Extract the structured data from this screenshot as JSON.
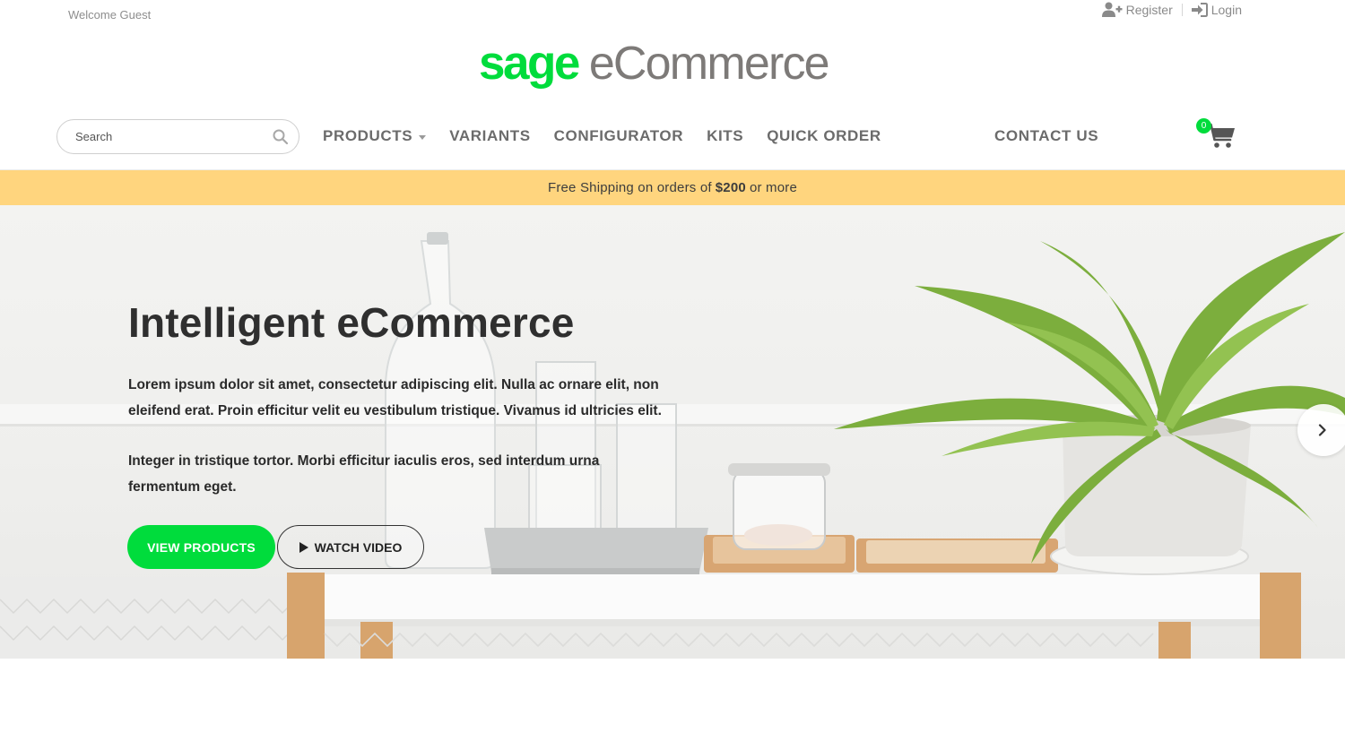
{
  "top_bar": {
    "welcome": "Welcome Guest",
    "register": "Register",
    "login": "Login"
  },
  "logo": {
    "brand": "sage",
    "product": "eCommerce"
  },
  "search": {
    "placeholder": "Search"
  },
  "nav": {
    "products": "PRODUCTS",
    "variants": "VARIANTS",
    "configurator": "CONFIGURATOR",
    "kits": "KITS",
    "quick_order": "QUICK ORDER",
    "contact_us": "CONTACT US"
  },
  "cart": {
    "count": "0"
  },
  "promo": {
    "prefix": "Free Shipping on orders of",
    "amount": "$200",
    "suffix": "or more"
  },
  "hero": {
    "title": "Intelligent eCommerce",
    "paragraph1": "Lorem ipsum dolor sit amet, consectetur adipiscing elit. Nulla ac ornare elit, non eleifend erat. Proin efficitur velit eu vestibulum tristique. Vivamus id ultricies elit.",
    "paragraph2": "Integer in tristique tortor. Morbi efficitur iaculis eros, sed interdum urna fermentum eget.",
    "primary_button": "VIEW PRODUCTS",
    "secondary_button": "WATCH VIDEO"
  },
  "colors": {
    "brand_green": "#00dc3c",
    "logo_gray": "#7d7a78",
    "promo_bg": "#ffd57e",
    "nav_text": "#6b6b6b"
  },
  "icons": {
    "register": "user-plus-icon",
    "login": "sign-in-icon",
    "search": "search-icon",
    "cart": "shopping-cart-icon",
    "carousel_next": "chevron-right-icon",
    "video": "play-icon"
  }
}
